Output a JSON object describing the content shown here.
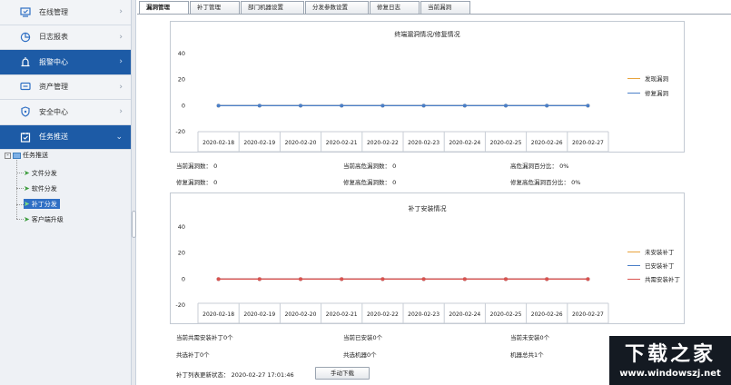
{
  "sidebar": {
    "items": [
      {
        "label": "在线管理",
        "icon": "monitor-check-icon"
      },
      {
        "label": "日志报表",
        "icon": "pie-chart-icon"
      },
      {
        "label": "报警中心",
        "icon": "alarm-icon"
      },
      {
        "label": "资产管理",
        "icon": "asset-icon"
      },
      {
        "label": "安全中心",
        "icon": "shield-icon"
      },
      {
        "label": "任务推送",
        "icon": "task-check-icon"
      }
    ],
    "tree": {
      "root": "任务推送",
      "children": [
        "文件分发",
        "软件分发",
        "补丁分发",
        "客户端升级"
      ]
    }
  },
  "tabs": [
    "漏洞管理",
    "补丁管理",
    "部门机器设置",
    "分发参数设置",
    "修复日志",
    "当前漏洞"
  ],
  "chart1": {
    "title": "终端漏洞情况/修复情况",
    "legend": [
      "发现漏洞",
      "修复漏洞"
    ]
  },
  "stats1": {
    "a": "当前漏洞数： 0",
    "b": "当前高危漏洞数： 0",
    "c": "高危漏洞百分比： 0%",
    "d": "修复漏洞数： 0",
    "e": "修复高危漏洞数： 0",
    "f": "修复高危漏洞百分比： 0%"
  },
  "chart2": {
    "title": "补丁安装情况",
    "legend": [
      "未安装补丁",
      "已安装补丁",
      "共需安装补丁"
    ]
  },
  "stats2": {
    "a": "当前共需安装补丁0个",
    "b": "当前已安装0个",
    "c": "当前未安装0个",
    "d": "共选补丁0个",
    "e": "共选机器0个",
    "f": "机器总共1个"
  },
  "footer": {
    "status": "补丁列表更新状态： 2020-02-27 17:01:46",
    "button": "手动下载"
  },
  "watermark": {
    "line1": "下载之家",
    "line2": "www.windowszj.net"
  },
  "colors": {
    "series_orange": "#e8a33c",
    "series_blue": "#4a7fc8",
    "series_red": "#d9534f",
    "nav_active": "#1d5ba6"
  },
  "chart_data": [
    {
      "type": "line",
      "title": "终端漏洞情况/修复情况",
      "x": [
        "2020-02-18",
        "2020-02-19",
        "2020-02-20",
        "2020-02-21",
        "2020-02-22",
        "2020-02-23",
        "2020-02-24",
        "2020-02-25",
        "2020-02-26",
        "2020-02-27"
      ],
      "yticks": [
        "40",
        "20",
        "0",
        "-20"
      ],
      "ylim": [
        -20,
        40
      ],
      "series": [
        {
          "name": "发现漏洞",
          "color": "#e8a33c",
          "values": [
            0,
            0,
            0,
            0,
            0,
            0,
            0,
            0,
            0,
            0
          ]
        },
        {
          "name": "修复漏洞",
          "color": "#4a7fc8",
          "values": [
            0,
            0,
            0,
            0,
            0,
            0,
            0,
            0,
            0,
            0
          ]
        }
      ],
      "legend": "right"
    },
    {
      "type": "line",
      "title": "补丁安装情况",
      "x": [
        "2020-02-18",
        "2020-02-19",
        "2020-02-20",
        "2020-02-21",
        "2020-02-22",
        "2020-02-23",
        "2020-02-24",
        "2020-02-25",
        "2020-02-26",
        "2020-02-27"
      ],
      "yticks": [
        "40",
        "20",
        "0",
        "-20"
      ],
      "ylim": [
        -20,
        40
      ],
      "series": [
        {
          "name": "未安装补丁",
          "color": "#e8a33c",
          "values": [
            0,
            0,
            0,
            0,
            0,
            0,
            0,
            0,
            0,
            0
          ]
        },
        {
          "name": "已安装补丁",
          "color": "#4a7fc8",
          "values": [
            0,
            0,
            0,
            0,
            0,
            0,
            0,
            0,
            0,
            0
          ]
        },
        {
          "name": "共需安装补丁",
          "color": "#d9534f",
          "values": [
            0,
            0,
            0,
            0,
            0,
            0,
            0,
            0,
            0,
            0
          ]
        }
      ],
      "legend": "right"
    }
  ]
}
